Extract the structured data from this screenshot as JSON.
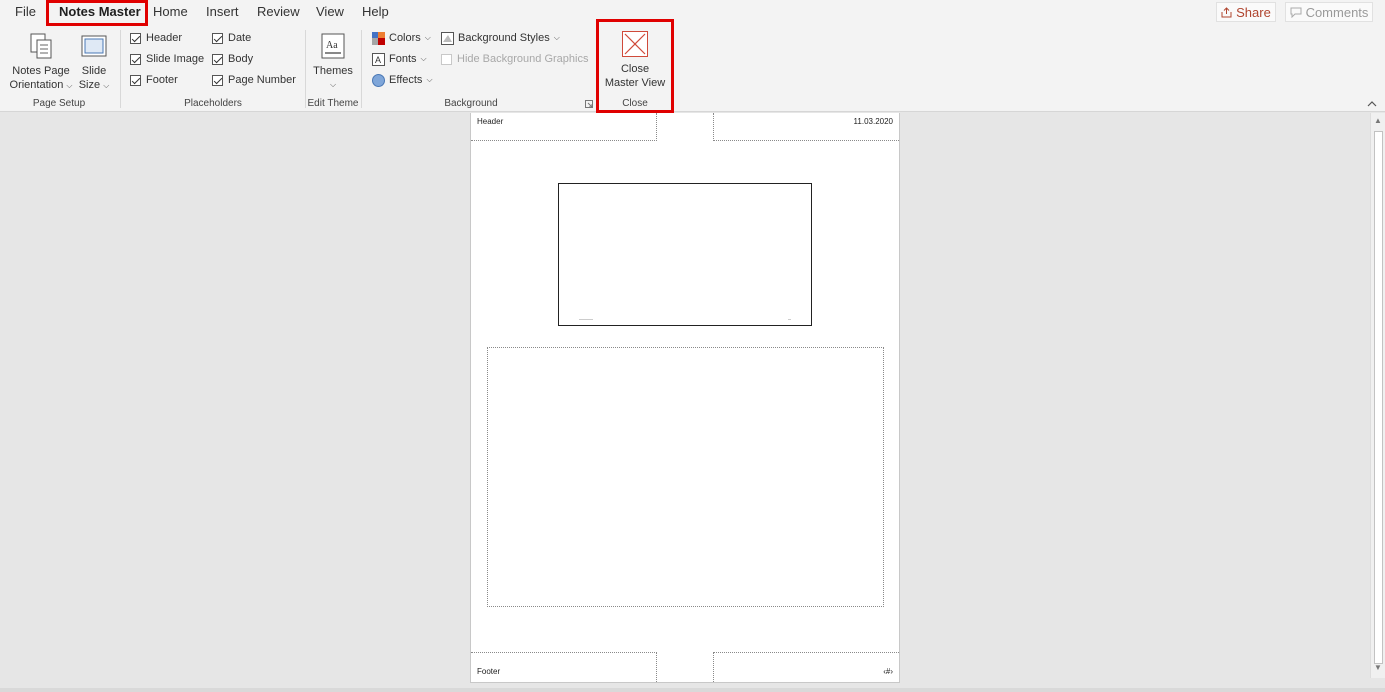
{
  "tabs": [
    {
      "label": "File"
    },
    {
      "label": "Notes Master"
    },
    {
      "label": "Home"
    },
    {
      "label": "Insert"
    },
    {
      "label": "Review"
    },
    {
      "label": "View"
    },
    {
      "label": "Help"
    }
  ],
  "active_tab": "Notes Master",
  "share": {
    "label": "Share"
  },
  "comments": {
    "label": "Comments"
  },
  "page_setup": {
    "group_label": "Page Setup",
    "orientation_line1": "Notes Page",
    "orientation_line2": "Orientation",
    "slide_size_line1": "Slide",
    "slide_size_line2": "Size"
  },
  "placeholders": {
    "group_label": "Placeholders",
    "items": [
      {
        "label": "Header",
        "checked": true
      },
      {
        "label": "Slide Image",
        "checked": true
      },
      {
        "label": "Footer",
        "checked": true
      },
      {
        "label": "Date",
        "checked": true
      },
      {
        "label": "Body",
        "checked": true
      },
      {
        "label": "Page Number",
        "checked": true
      }
    ]
  },
  "edit_theme": {
    "group_label": "Edit Theme",
    "themes_label": "Themes"
  },
  "background": {
    "group_label": "Background",
    "colors_label": "Colors",
    "fonts_label": "Fonts",
    "effects_label": "Effects",
    "background_styles_label": "Background Styles",
    "hide_graphics_label": "Hide Background Graphics"
  },
  "close": {
    "group_label": "Close",
    "line1": "Close",
    "line2": "Master View"
  },
  "page": {
    "header_text": "Header",
    "date_text": "11.03.2020",
    "footer_text": "Footer",
    "page_number_text": "‹#›"
  },
  "colors": {
    "accent_red": "#e00000",
    "share_text": "#b0452f"
  }
}
